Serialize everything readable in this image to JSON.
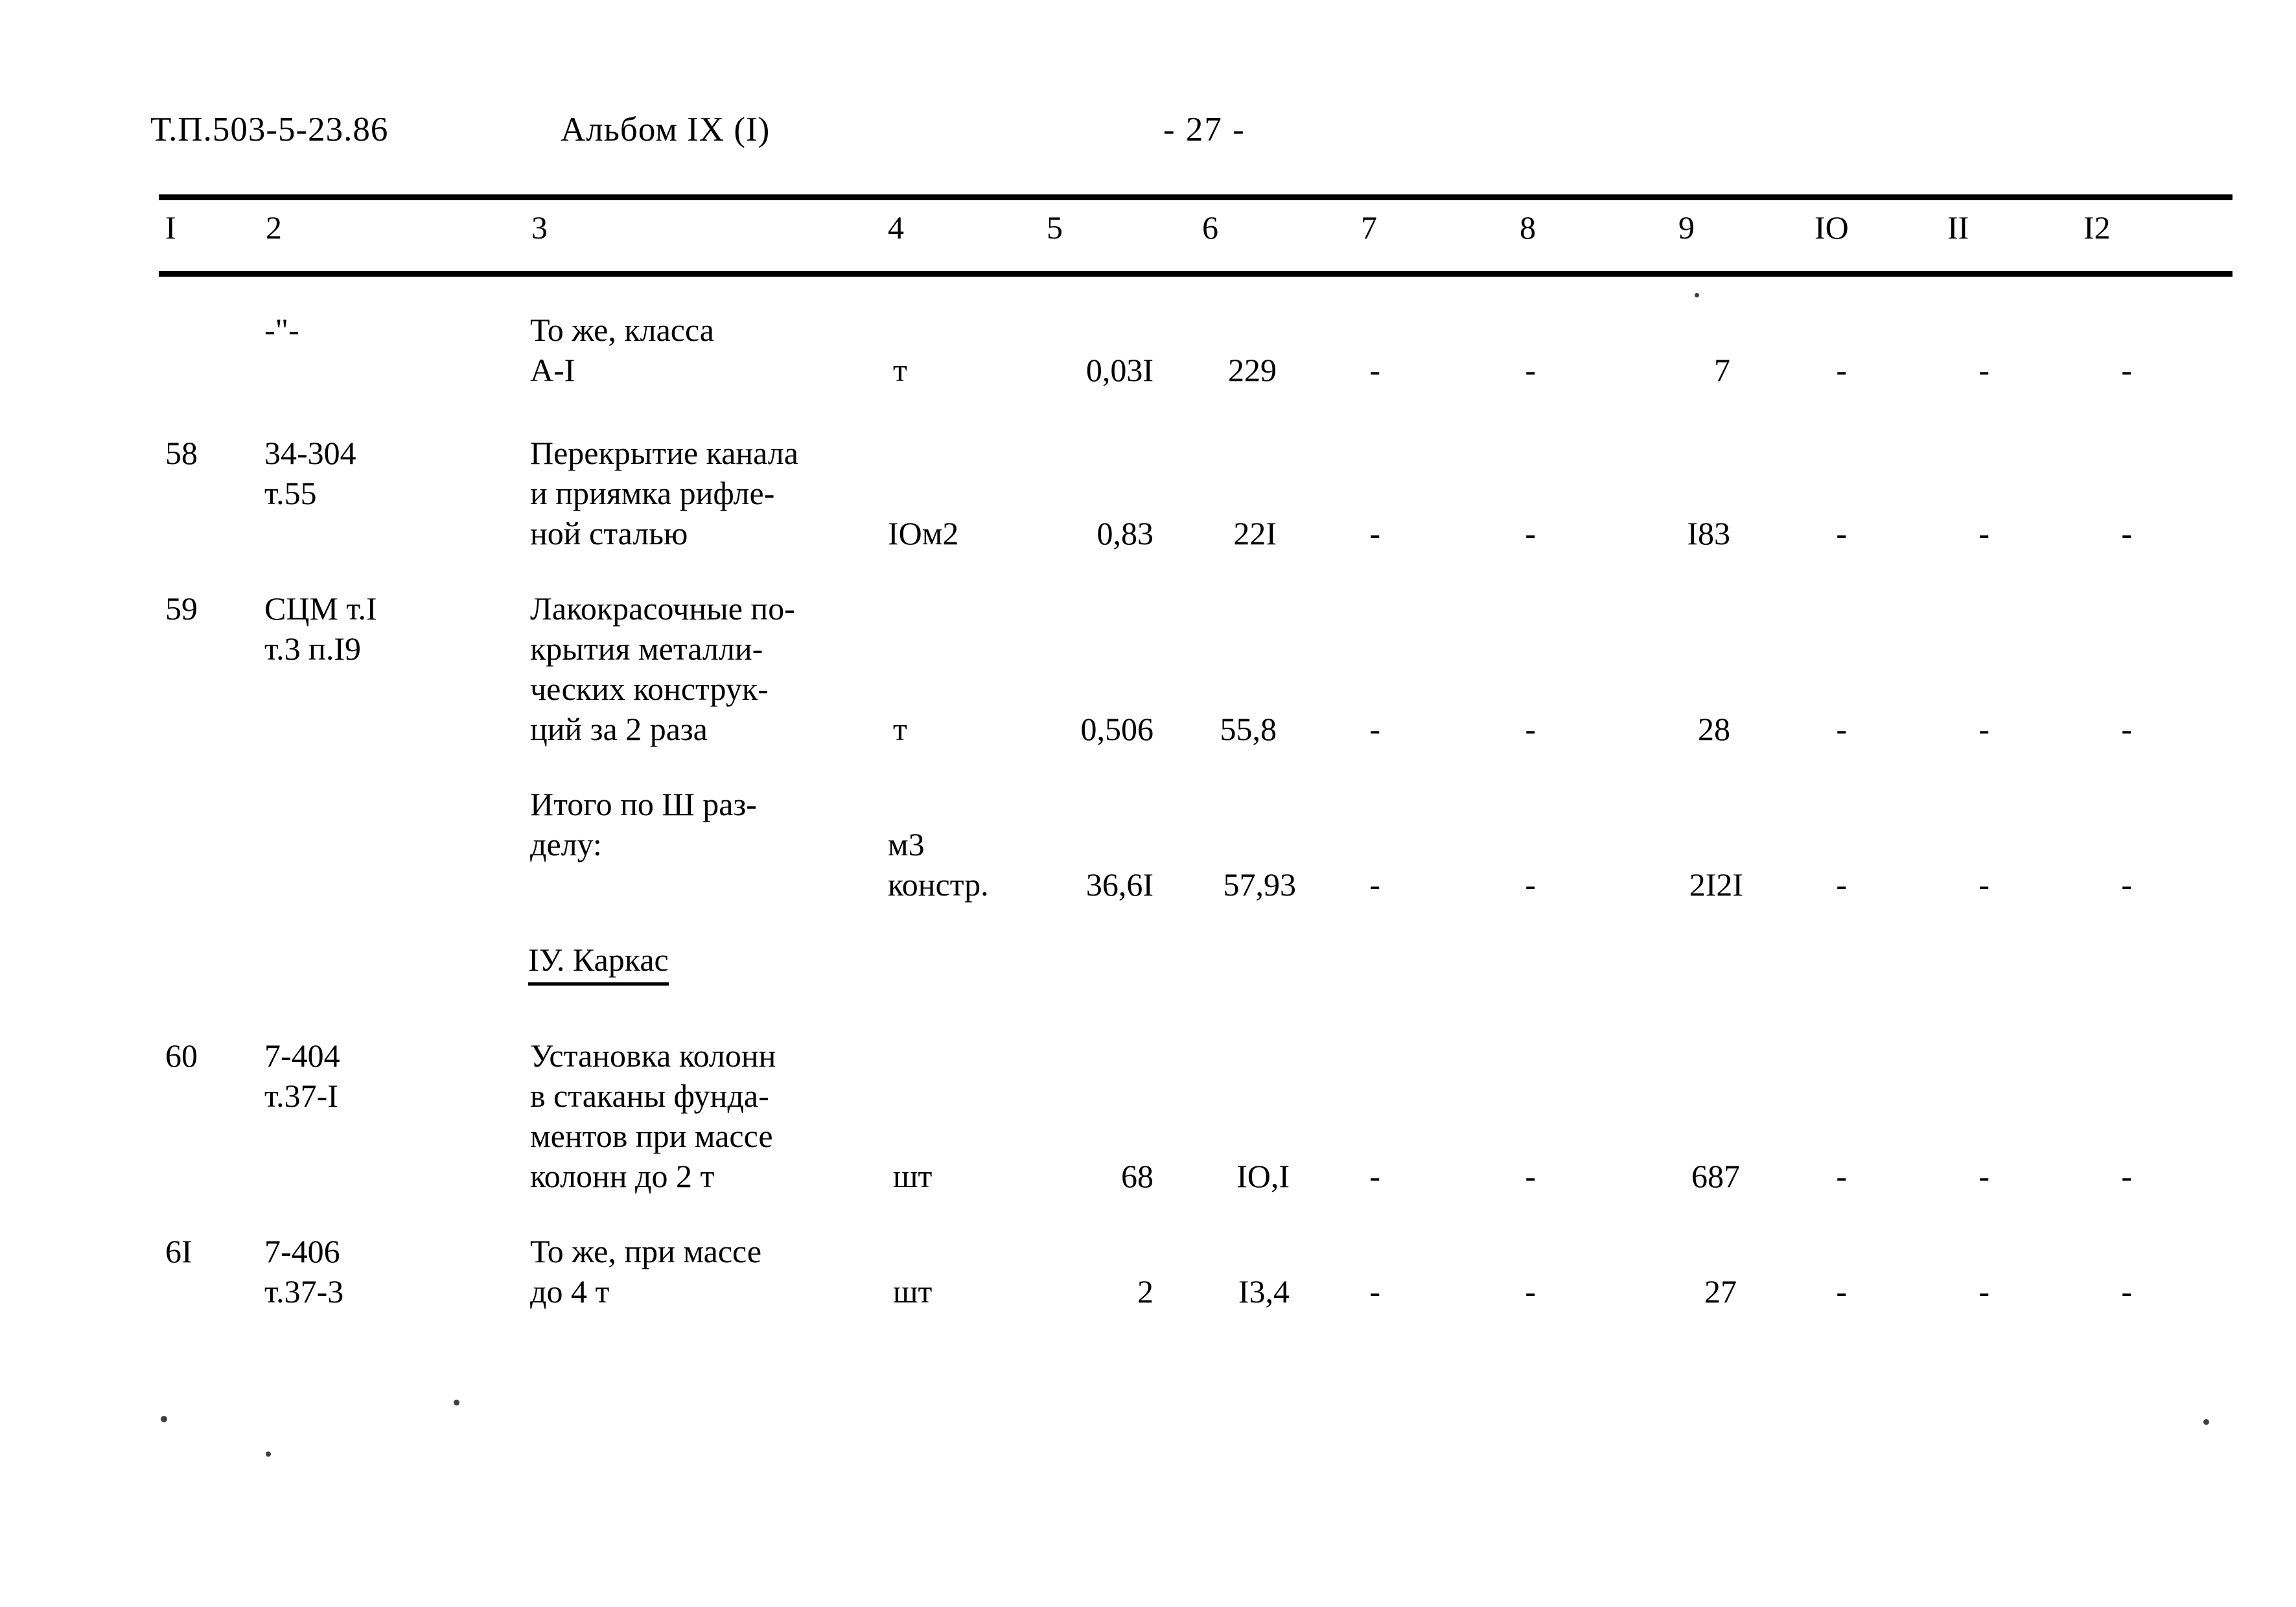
{
  "header": {
    "doc_code": "Т.П.503-5-23.86",
    "album": "Альбом IX (I)",
    "page_number": "- 27 -"
  },
  "table": {
    "column_headers": [
      "I",
      "2",
      "3",
      "4",
      "5",
      "6",
      "7",
      "8",
      "9",
      "IO",
      "II",
      "I2"
    ],
    "rows": [
      {
        "num": "",
        "code": "-\"-",
        "description": [
          "То же, класса",
          "А-I"
        ],
        "unit": "т",
        "c5": "0,03I",
        "c6": "229",
        "c7": "-",
        "c8": "-",
        "c9": "7",
        "c10": "-",
        "c11": "-",
        "c12": "-"
      },
      {
        "num": "58",
        "code": "34-304\nт.55",
        "description": [
          "Перекрытие канала",
          "и приямка рифле-",
          "ной сталью"
        ],
        "unit": "IОм2",
        "c5": "0,83",
        "c6": "22I",
        "c7": "-",
        "c8": "-",
        "c9": "I83",
        "c10": "-",
        "c11": "-",
        "c12": "-"
      },
      {
        "num": "59",
        "code": "СЦМ т.I\nт.3 п.I9",
        "description": [
          "Лакокрасочные по-",
          "крытия металли-",
          "ческих конструк-",
          "ций за 2 раза"
        ],
        "unit": "т",
        "c5": "0,506",
        "c6": "55,8",
        "c7": "-",
        "c8": "-",
        "c9": "28",
        "c10": "-",
        "c11": "-",
        "c12": "-"
      },
      {
        "num": "",
        "code": "",
        "description": [
          "Итого по Ш раз-",
          "делу:"
        ],
        "unit": "м3\nконстр.",
        "c5": "36,6I",
        "c6": "57,93",
        "c7": "-",
        "c8": "-",
        "c9": "2I2I",
        "c10": "-",
        "c11": "-",
        "c12": "-"
      },
      {
        "num": "60",
        "code": "7-404\nт.37-I",
        "description": [
          "Установка колонн",
          "в стаканы фунда-",
          "ментов при массе",
          "колонн до 2 т"
        ],
        "unit": "шт",
        "c5": "68",
        "c6": "IО,I",
        "c7": "-",
        "c8": "-",
        "c9": "687",
        "c10": "-",
        "c11": "-",
        "c12": "-"
      },
      {
        "num": "6I",
        "code": "7-406\nт.37-3",
        "description": [
          "То же, при массе",
          "до 4 т"
        ],
        "unit": "шт",
        "c5": "2",
        "c6": "I3,4",
        "c7": "-",
        "c8": "-",
        "c9": "27",
        "c10": "-",
        "c11": "-",
        "c12": "-"
      }
    ],
    "section_heading": "IУ. Каркас"
  }
}
